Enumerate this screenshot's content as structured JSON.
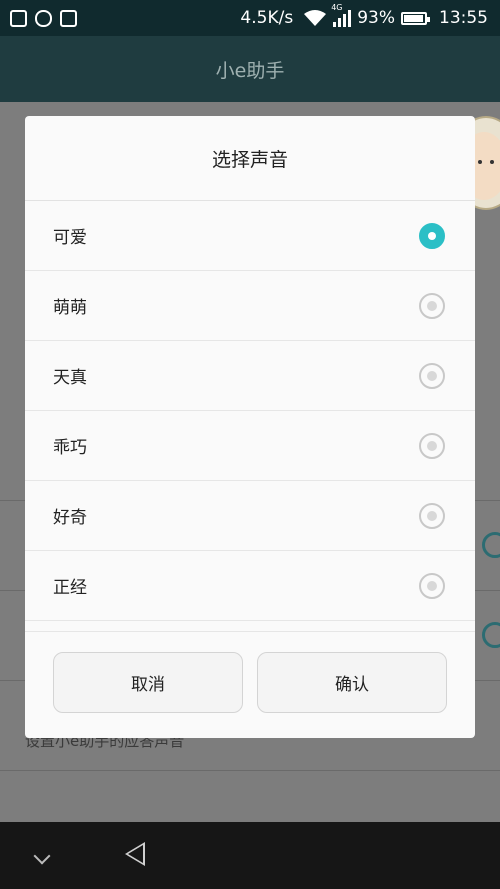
{
  "status_bar": {
    "net_speed": "4.5K/s",
    "network_tag": "4G",
    "battery": "93%",
    "battery_level": 0.93,
    "time": "13:55"
  },
  "app_bar": {
    "title": "小e助手"
  },
  "background": {
    "hint_text": "设置小e助手的应答声音"
  },
  "dialog": {
    "title": "选择声音",
    "options": [
      {
        "label": "可爱",
        "selected": true
      },
      {
        "label": "萌萌",
        "selected": false
      },
      {
        "label": "天真",
        "selected": false
      },
      {
        "label": "乖巧",
        "selected": false
      },
      {
        "label": "好奇",
        "selected": false
      },
      {
        "label": "正经",
        "selected": false
      }
    ],
    "cancel_label": "取消",
    "confirm_label": "确认"
  },
  "colors": {
    "accent": "#2bbfc6",
    "statusbar": "#102a2e"
  }
}
